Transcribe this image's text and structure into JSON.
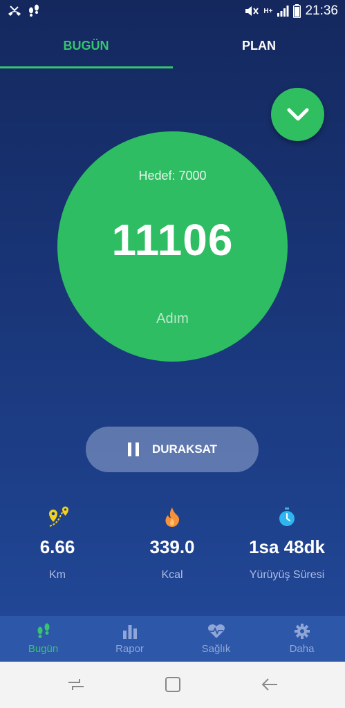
{
  "status_bar": {
    "time": "21:36",
    "network": "H+"
  },
  "tabs": [
    {
      "label": "BUGÜN",
      "active": true
    },
    {
      "label": "PLAN",
      "active": false
    }
  ],
  "goal": {
    "label": "Hedef: 7000"
  },
  "steps": {
    "value": "11106",
    "unit": "Adım"
  },
  "pause_button": {
    "label": "DURAKSAT",
    "icon": "pause-icon"
  },
  "stats": [
    {
      "value": "6.66",
      "label": "Km",
      "icon": "route-pin-icon"
    },
    {
      "value": "339.0",
      "label": "Kcal",
      "icon": "flame-icon"
    },
    {
      "value": "1sa 48dk",
      "label": "Yürüyüş Süresi",
      "icon": "stopwatch-icon"
    }
  ],
  "bottom_nav": [
    {
      "label": "Bugün",
      "icon": "footsteps-icon",
      "active": true
    },
    {
      "label": "Rapor",
      "icon": "bar-chart-icon",
      "active": false
    },
    {
      "label": "Sağlık",
      "icon": "heart-pulse-icon",
      "active": false
    },
    {
      "label": "Daha",
      "icon": "gear-icon",
      "active": false
    }
  ],
  "colors": {
    "accent_green": "#2ebd62",
    "tab_active": "#36c46e",
    "background_top": "#14285e",
    "background_bottom": "#234c9e",
    "nav_inactive": "#8fa6d6",
    "stat_route": "#f5d21a",
    "stat_flame": "#f7913a",
    "stat_stopwatch": "#2fb6f0"
  }
}
